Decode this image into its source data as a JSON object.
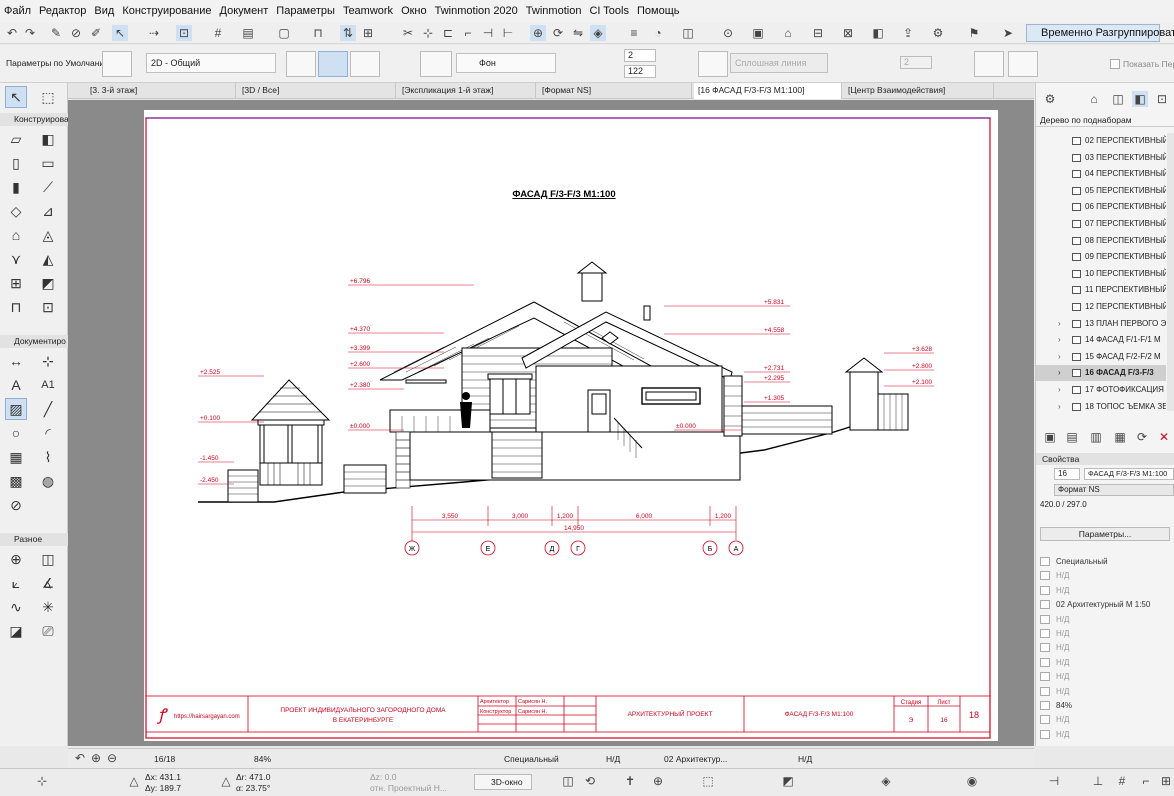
{
  "menu": [
    "Файл",
    "Редактор",
    "Вид",
    "Конструирование",
    "Документ",
    "Параметры",
    "Teamwork",
    "Окно",
    "Twinmotion 2020",
    "Twinmotion",
    "CI Tools",
    "Помощь"
  ],
  "toolbar": {
    "regroup_label": "Временно Разгруппировать"
  },
  "infobox": {
    "default_params": "Параметры по Умолчанию",
    "view_dropdown": "2D - Общий",
    "fill_dropdown": "Фон",
    "pen1": "2",
    "pen2": "122",
    "line_type": "Сплошная линия",
    "pen3": "2",
    "show_label": "Показать Пер"
  },
  "tabs": [
    "[3. 3-й этаж]",
    "[3D / Все]",
    "[Экспликация 1-й этаж]",
    "[Формат NS]",
    "[16 ФАСАД F/3-F/3 M1:100]",
    "[Центр Взаимодействия]"
  ],
  "toolbox": {
    "design_section": "Конструирова",
    "document_section": "Документиро",
    "misc_section": "Разное",
    "text_tool_label": "A1"
  },
  "navigator": {
    "dropdown": "Дерево по поднаборам",
    "items": [
      "02 ПЕРСПЕКТИВНЫЙ",
      "03 ПЕРСПЕКТИВНЫЙ",
      "04 ПЕРСПЕКТИВНЫЙ",
      "05 ПЕРСПЕКТИВНЫЙ",
      "06 ПЕРСПЕКТИВНЫЙ",
      "07 ПЕРСПЕКТИВНЫЙ",
      "08 ПЕРСПЕКТИВНЫЙ",
      "09 ПЕРСПЕКТИВНЫЙ",
      "10 ПЕРСПЕКТИВНЫЙ",
      "11 ПЕРСПЕКТИВНЫЙ",
      "12 ПЕРСПЕКТИВНЫЙ",
      "13 ПЛАН ПЕРВОГО Э",
      "14 ФАСАД F/1-F/1 M",
      "15 ФАСАД F/2-F/2 M",
      "16 ФАСАД F/3-F/3",
      "17 ФОТОФИКСАЦИЯ",
      "18 ТОПОС ЪЕМКА ЗЕ"
    ],
    "selected_index": 14
  },
  "properties": {
    "header": "Свойства",
    "id": "16",
    "name": "ФАСАД F/3-F/3 M1:100",
    "master": "Формат NS",
    "size": "420.0 / 297.0",
    "params_button": "Параметры...",
    "rows": [
      "Специальный",
      "Н/Д",
      "Н/Д",
      "02 Архитектурный М 1:50",
      "Н/Д",
      "Н/Д",
      "Н/Д",
      "Н/Д",
      "Н/Д",
      "Н/Д",
      "84%",
      "Н/Д",
      "Н/Д"
    ]
  },
  "drawing": {
    "title": "ФАСАД F/3-F/3 M1:100",
    "levels_left": [
      "+6.796",
      "+4.370",
      "+3.399",
      "+2.600",
      "+2.380",
      "+2.525",
      "+0.100",
      "±0.000",
      "-1.450",
      "-2.450",
      "±0.000"
    ],
    "levels_right": [
      "+5.831",
      "+4.558",
      "+2.731",
      "+2.295",
      "+1.305",
      "+3.628",
      "+2.800",
      "+2.100"
    ],
    "dims": [
      "3,550",
      "3,000",
      "1,200",
      "6,000",
      "1,200"
    ],
    "total_dim": "14,950",
    "axes": [
      "Ж",
      "Е",
      "Д",
      "Г",
      "Б",
      "А"
    ]
  },
  "titleblock": {
    "url": "https://hairsargayan.com",
    "project": "ПРОЕКТ ИНДИВИДУАЛЬНОГО ЗАГОРОДНОГО ДОМА В ЕКАТЕРИНБУРГЕ",
    "role1": "Архитектор",
    "name1": "Сарисян Н.",
    "role2": "Конструктор",
    "name2": "Сарисян Н.",
    "type": "АРХИТЕКТУРНЫЙ ПРОЕКТ",
    "sheet_title": "ФАСАД F/3-F/3 M1:100",
    "stage_label": "Стадия",
    "sheet_label": "Лист",
    "stage": "Э",
    "sheet_no": "16",
    "total": "18"
  },
  "status": {
    "page": "16/18",
    "zoom": "84%",
    "layer": "Специальный",
    "nd1": "Н/Д",
    "nd2": "Н/Д",
    "scale": "02 Архитектур...",
    "dx": "Δx: 431.1",
    "dy": "Δy: 189.7",
    "dr": "Δr: 471.0",
    "da": "α: 23.75°",
    "dz": "Δz: 0.0",
    "ref": "отн. Проектный Н...",
    "view3d": "3D-окно"
  },
  "colors": {
    "accent": "#d6001c",
    "selection": "#cfe0f2"
  }
}
